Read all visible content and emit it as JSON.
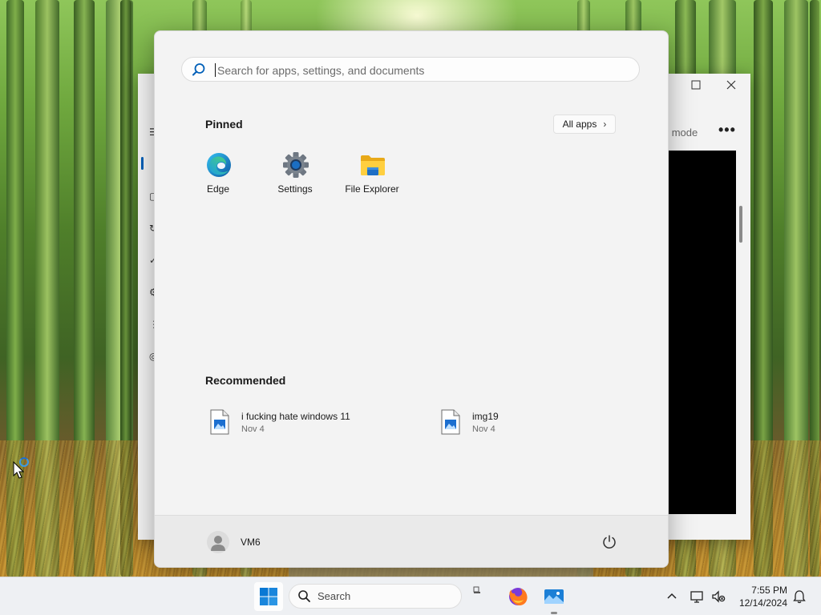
{
  "start_menu": {
    "search_placeholder": "Search for apps, settings, and documents",
    "pinned_title": "Pinned",
    "all_apps_label": "All apps",
    "pinned_apps": [
      {
        "label": "Edge",
        "icon": "edge-icon"
      },
      {
        "label": "Settings",
        "icon": "settings-gear-icon"
      },
      {
        "label": "File Explorer",
        "icon": "folder-icon"
      }
    ],
    "recommended_title": "Recommended",
    "recommended": [
      {
        "name": "i fucking hate windows 11",
        "date": "Nov 4",
        "icon": "image-file-icon"
      },
      {
        "name": "img19",
        "date": "Nov 4",
        "icon": "image-file-icon"
      }
    ],
    "user_name": "VM6"
  },
  "background_window": {
    "mode_text": "ty mode",
    "more_label": "•••"
  },
  "taskbar": {
    "search_label": "Search",
    "time": "7:55 PM",
    "date": "12/14/2024"
  },
  "colors": {
    "accent": "#005fb8",
    "start_bg": "#f3f3f3",
    "taskbar_bg": "#eef0f3"
  }
}
